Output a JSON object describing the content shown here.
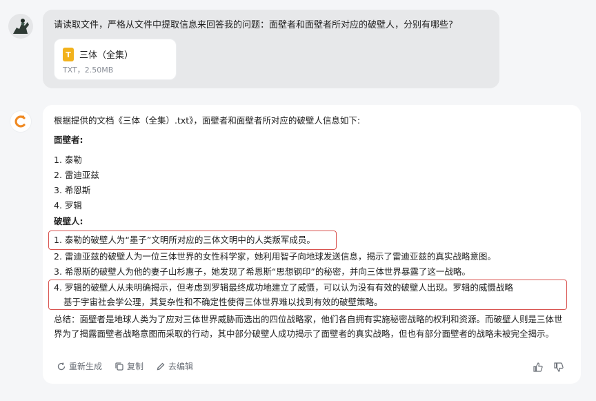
{
  "user": {
    "message": "请读取文件，严格从文件中提取信息来回答我的问题：面壁者和面壁者所对应的破壁人，分别有哪些?",
    "file": {
      "name": "三体（全集）",
      "meta": "TXT，2.50MB",
      "icon_letter": "T"
    }
  },
  "assistant": {
    "intro": "根据提供的文档《三体（全集）.txt》，面壁者和面壁者所对应的破壁人信息如下:",
    "wallfacers_heading": "面壁者:",
    "wallfacers": [
      "1. 泰勒",
      "2. 雷迪亚兹",
      "3. 希恩斯",
      "4. 罗辑"
    ],
    "wallbreakers_heading": "破壁人:",
    "wallbreakers": [
      "1. 泰勒的破壁人为“墨子”文明所对应的三体文明中的人类叛军成员。",
      "2. 雷迪亚兹的破壁人为一位三体世界的女性科学家，她利用智子向地球发送信息，揭示了雷迪亚兹的真实战略意图。",
      "3. 希恩斯的破壁人为他的妻子山杉惠子，她发现了希恩斯“思想钢印”的秘密，并向三体世界暴露了这一战略。",
      "4. 罗辑的破壁人从未明确揭示，但考虑到罗辑最终成功地建立了威慑，可以认为没有有效的破壁人出现。罗辑的威慑战略",
      "基于宇宙社会学公理，其复杂性和不确定性使得三体世界难以找到有效的破壁策略。"
    ],
    "summary": "总结：面壁者是地球人类为了应对三体世界威胁而选出的四位战略家，他们各自拥有实施秘密战略的权利和资源。而破壁人则是三体世界为了揭露面壁者战略意图而采取的行动，其中部分破壁人成功揭示了面壁者的真实战略，但也有部分面壁者的战略未被完全揭示。",
    "actions": {
      "regenerate": "重新生成",
      "copy": "复制",
      "edit": "去编辑"
    }
  },
  "colors": {
    "highlight": "#d9534f",
    "ai_logo": "#f08a24",
    "file_icon": "#f2b21c"
  }
}
